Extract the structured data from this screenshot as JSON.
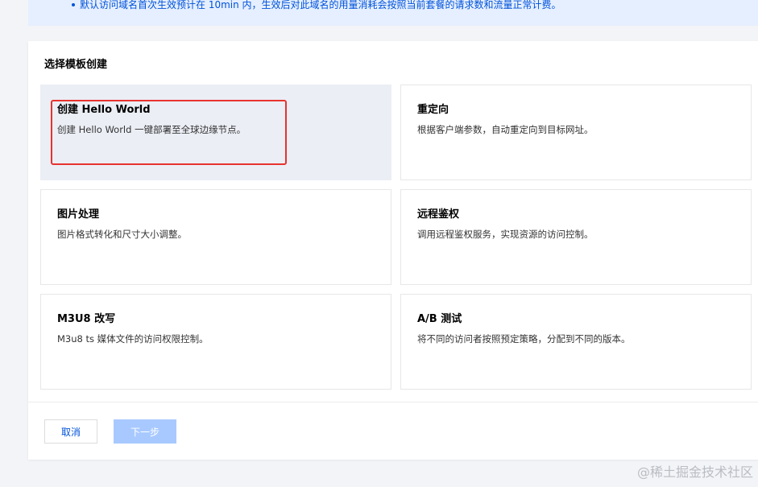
{
  "notice": {
    "text": "默认访问域名首次生效预计在 10min 内，生效后对此域名的用量消耗会按照当前套餐的请求数和流量正常计费。"
  },
  "section": {
    "title": "选择模板创建"
  },
  "templates": [
    {
      "title": "创建 Hello World",
      "desc": "创建 Hello World 一键部署至全球边缘节点。",
      "selected": true
    },
    {
      "title": "重定向",
      "desc": "根据客户端参数，自动重定向到目标网址。",
      "selected": false
    },
    {
      "title": "图片处理",
      "desc": "图片格式转化和尺寸大小调整。",
      "selected": false
    },
    {
      "title": "远程鉴权",
      "desc": "调用远程鉴权服务，实现资源的访问控制。",
      "selected": false
    },
    {
      "title": "M3U8 改写",
      "desc": "M3u8 ts 媒体文件的访问权限控制。",
      "selected": false
    },
    {
      "title": "A/B 测试",
      "desc": "将不同的访问者按照预定策略，分配到不同的版本。",
      "selected": false
    }
  ],
  "footer": {
    "cancel_label": "取消",
    "next_label": "下一步"
  },
  "watermark": {
    "text": "@稀土掘金技术社区"
  },
  "colors": {
    "accent": "#0052d9",
    "selected_card_bg": "#ebeef5",
    "highlight_border": "#e8332f",
    "disabled_button": "#a8c9ff"
  }
}
